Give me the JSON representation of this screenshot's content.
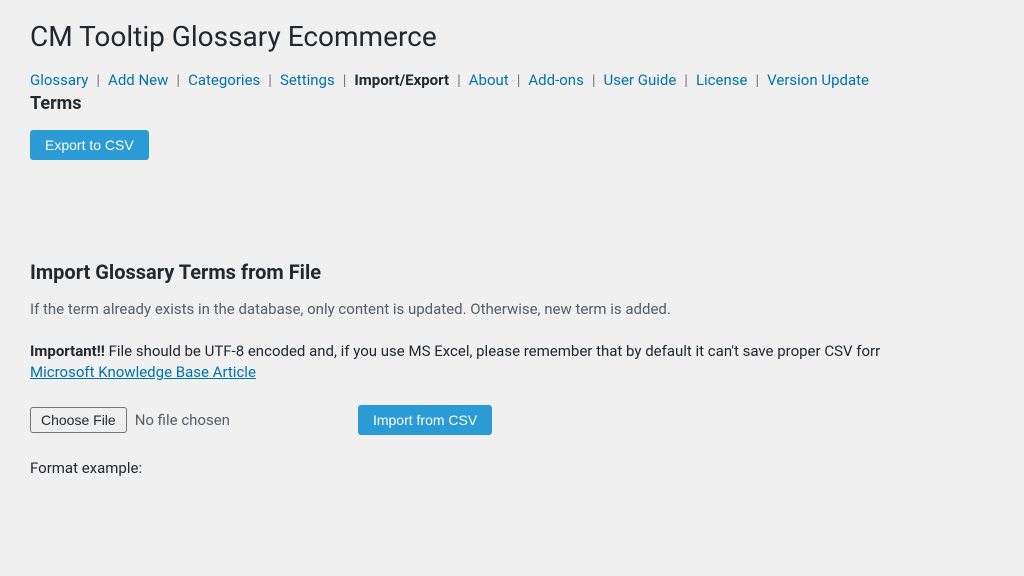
{
  "page_title": "CM Tooltip Glossary Ecommerce",
  "nav": {
    "items": [
      {
        "label": "Glossary",
        "active": false
      },
      {
        "label": "Add New",
        "active": false
      },
      {
        "label": "Categories",
        "active": false
      },
      {
        "label": "Settings",
        "active": false
      },
      {
        "label": "Import/Export",
        "active": true
      },
      {
        "label": "About",
        "active": false
      },
      {
        "label": "Add-ons",
        "active": false
      },
      {
        "label": "User Guide",
        "active": false
      },
      {
        "label": "License",
        "active": false
      },
      {
        "label": "Version Update",
        "active": false
      }
    ],
    "separator": "|"
  },
  "terms_heading": "Terms",
  "export_button": "Export to CSV",
  "import_section": {
    "title": "Import Glossary Terms from File",
    "description": "If the term already exists in the database, only content is updated. Otherwise, new term is added.",
    "important_label": "Important!!",
    "important_text": " File should be UTF-8 encoded and, if you use MS Excel, please remember that by default it can't save proper CSV forr",
    "kb_link": "Microsoft Knowledge Base Article",
    "choose_file": "Choose File",
    "file_status": "No file chosen",
    "import_button": "Import from CSV",
    "format_label": "Format example:"
  }
}
